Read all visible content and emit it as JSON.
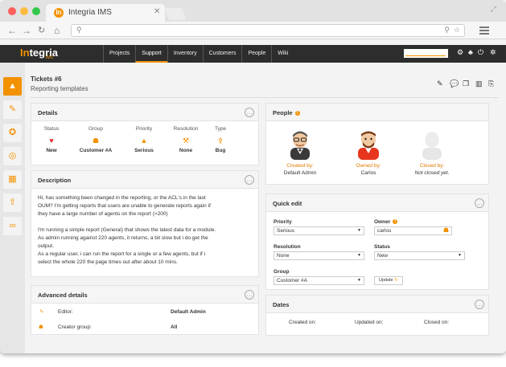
{
  "browser": {
    "tab_title": "Integria IMS",
    "tab_favicon": "In",
    "tab_close": "✕",
    "back_icon": "arrow-left-icon",
    "forward_icon": "arrow-right-icon",
    "reload_icon": "reload-icon",
    "home_icon": "home-icon"
  },
  "app": {
    "logo_left": "In",
    "logo_right": "tegria",
    "logo_sub": "IMS",
    "nav": [
      "Projects",
      "Support",
      "Inventory",
      "Customers",
      "People",
      "Wiki"
    ],
    "active_nav": "Support"
  },
  "ticket": {
    "title": "Tickets #6",
    "subtitle": "Reporting templates"
  },
  "details": {
    "title": "Details",
    "columns": [
      {
        "header": "Status",
        "value": "New",
        "icon": "heart-icon",
        "color": "#e8232f"
      },
      {
        "header": "Group",
        "value": "Customer #A",
        "icon": "group-icon",
        "color": "#f39200"
      },
      {
        "header": "Priority",
        "value": "Serious",
        "icon": "warning-icon",
        "color": "#f39200"
      },
      {
        "header": "Resolution",
        "value": "None",
        "icon": "resolution-icon",
        "color": "#f39200"
      },
      {
        "header": "Type",
        "value": "Bug",
        "icon": "bug-icon",
        "color": "#f39200"
      }
    ]
  },
  "description": {
    "title": "Description",
    "lines": [
      "Hi, has something been changed in the reporting, or the ACL's in the last",
      "OUM? I'm getting reports that users are unable to generate reports again if",
      "they have a large number of agents on the report (>200)",
      "",
      "I'm running a simple report (General) that shows the latest data for a module.",
      "As admin running against 220 agents, it returns, a bit slow but i do get the",
      "output.",
      "As a regular user, i can run the report for a single or a few agents, but if i",
      "select the whole 220 the page times out after about 10 mins."
    ]
  },
  "advanced": {
    "title": "Advanced details",
    "rows": [
      {
        "label": "Editor:",
        "value": "Default Admin",
        "icon": "pencil-icon"
      },
      {
        "label": "Creator group:",
        "value": "All",
        "icon": "group-icon"
      }
    ]
  },
  "people": {
    "title": "People",
    "items": [
      {
        "label": "Created by:",
        "value": "Default Admin",
        "icon": "admin-avatar-icon"
      },
      {
        "label": "Owned by:",
        "value": "Carlos",
        "icon": "owner-avatar-icon"
      },
      {
        "label": "Closed by:",
        "value": "Not closed yet.",
        "icon": "empty-avatar-icon"
      }
    ]
  },
  "quickedit": {
    "title": "Quick edit",
    "priority_label": "Priority",
    "priority_value": "Serious",
    "owner_label": "Owner",
    "owner_value": "carlos",
    "resolution_label": "Resolution",
    "resolution_value": "None",
    "status_label": "Status",
    "status_value": "New",
    "group_label": "Group",
    "group_value": "Customer #A",
    "update_label": "Update"
  },
  "dates": {
    "title": "Dates",
    "created": "Created on:",
    "updated": "Updated on:",
    "closed": "Closed on:"
  },
  "colors": {
    "accent": "#f39200",
    "header_bg": "#2d2d2d"
  }
}
